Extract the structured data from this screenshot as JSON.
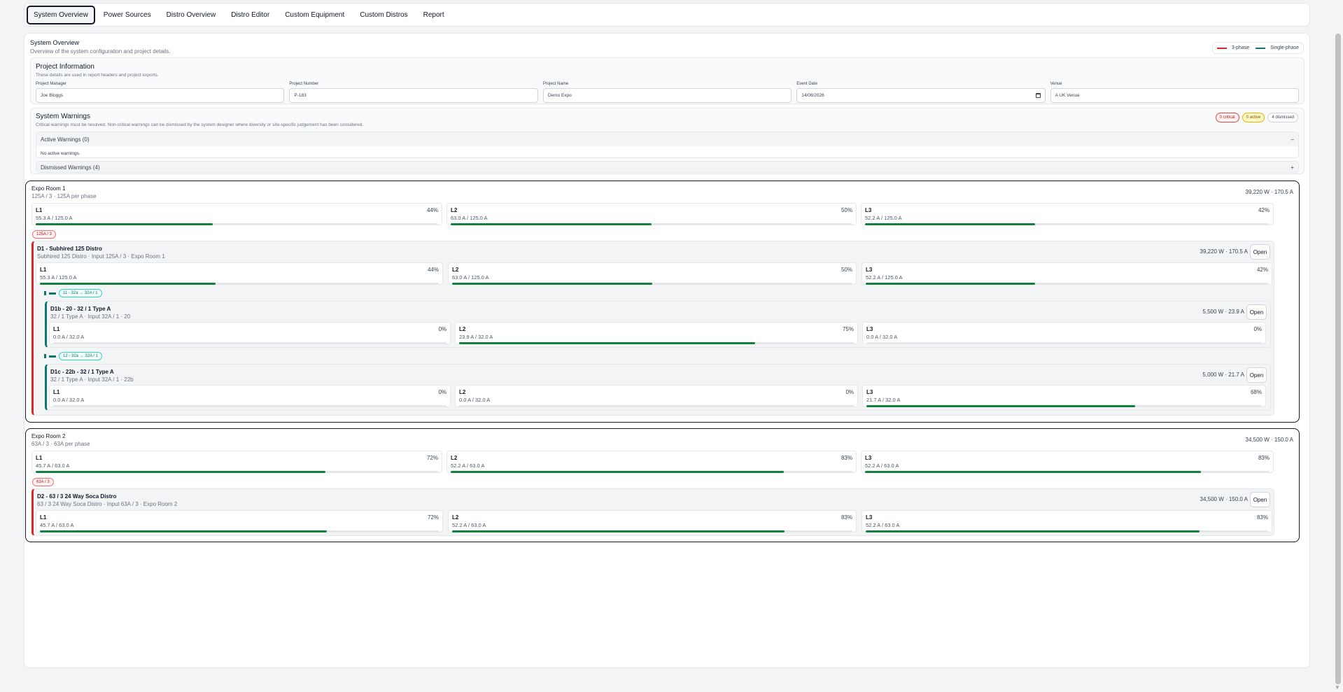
{
  "tabs": [
    "System Overview",
    "Power Sources",
    "Distro Overview",
    "Distro Editor",
    "Custom Equipment",
    "Custom Distros",
    "Report"
  ],
  "header": {
    "title": "System Overview",
    "subtitle": "Overview of the system configuration and project details.",
    "legend_3phase": "3-phase",
    "legend_single": "Single-phase",
    "color_3phase": "#dc2626",
    "color_single": "#0f766e"
  },
  "project": {
    "title": "Project Information",
    "subtitle": "These details are used in report headers and project exports.",
    "fields": [
      {
        "label": "Project Manager",
        "value": "Joe Bloggs"
      },
      {
        "label": "Project Number",
        "value": "P-183"
      },
      {
        "label": "Project Name",
        "value": "Demo Expo"
      },
      {
        "label": "Event Date",
        "value": "14/08/2026"
      },
      {
        "label": "Venue",
        "value": "A UK Venue"
      }
    ]
  },
  "warnings": {
    "title": "System Warnings",
    "subtitle": "Critical warnings must be resolved. Non-critical warnings can be dismissed by the system designer where diversity or site-specific judgement has been considered.",
    "badge_critical": "0 critical",
    "badge_active": "0 active",
    "badge_dismissed": "4 dismissed",
    "active_label": "Active Warnings (0)",
    "active_toggle": "–",
    "active_empty": "No active warnings.",
    "dismissed_label": "Dismissed Warnings (4)",
    "dismissed_toggle": "+"
  },
  "rooms": [
    {
      "name": "Expo Room 1",
      "sub": "125A / 3 · 125A per phase",
      "total": "39,220 W · 170.5 A",
      "phases": [
        {
          "name": "L1",
          "pct": "44%",
          "val": "55.3 A / 125.0 A",
          "fill": 0.44
        },
        {
          "name": "L2",
          "pct": "50%",
          "val": "63.0 A / 125.0 A",
          "fill": 0.5
        },
        {
          "name": "L3",
          "pct": "42%",
          "val": "52.2 A / 125.0 A",
          "fill": 0.42
        }
      ],
      "chip": "125A / 3",
      "distro": {
        "name": "D1 - Subhired 125 Distro",
        "sub": "Subhired 125 Distro · Input 125A / 3 · Expo Room 1",
        "total": "39,220 W · 170.5 A",
        "open": "Open",
        "phases": [
          {
            "name": "L1",
            "pct": "44%",
            "val": "55.3 A / 125.0 A",
            "fill": 0.44
          },
          {
            "name": "L2",
            "pct": "50%",
            "val": "63.0 A / 125.0 A",
            "fill": 0.5
          },
          {
            "name": "L3",
            "pct": "42%",
            "val": "52.2 A / 125.0 A",
            "fill": 0.42
          }
        ],
        "children": [
          {
            "chip": "11 - 32a → 32A / 1",
            "name": "D1b - 20 - 32 / 1 Type A",
            "sub": "32 / 1 Type A · Input 32A / 1 · 20",
            "total": "5,500 W · 23.9 A",
            "open": "Open",
            "phases": [
              {
                "name": "L1",
                "pct": "0%",
                "val": "0.0 A / 32.0 A",
                "fill": 0
              },
              {
                "name": "L2",
                "pct": "75%",
                "val": "23.9 A / 32.0 A",
                "fill": 0.75
              },
              {
                "name": "L3",
                "pct": "0%",
                "val": "0.0 A / 32.0 A",
                "fill": 0
              }
            ]
          },
          {
            "chip": "12 - 32a → 32A / 1",
            "name": "D1c - 22b - 32 / 1 Type A",
            "sub": "32 / 1 Type A · Input 32A / 1 · 22b",
            "total": "5,000 W · 21.7 A",
            "open": "Open",
            "phases": [
              {
                "name": "L1",
                "pct": "0%",
                "val": "0.0 A / 32.0 A",
                "fill": 0
              },
              {
                "name": "L2",
                "pct": "0%",
                "val": "0.0 A / 32.0 A",
                "fill": 0
              },
              {
                "name": "L3",
                "pct": "68%",
                "val": "21.7 A / 32.0 A",
                "fill": 0.68
              }
            ]
          }
        ]
      }
    },
    {
      "name": "Expo Room 2",
      "sub": "63A / 3 · 63A per phase",
      "total": "34,500 W · 150.0 A",
      "phases": [
        {
          "name": "L1",
          "pct": "72%",
          "val": "45.7 A / 63.0 A",
          "fill": 0.72
        },
        {
          "name": "L2",
          "pct": "83%",
          "val": "52.2 A / 63.0 A",
          "fill": 0.83
        },
        {
          "name": "L3",
          "pct": "83%",
          "val": "52.2 A / 63.0 A",
          "fill": 0.83
        }
      ],
      "chip": "63A / 3",
      "distro": {
        "name": "D2 - 63 / 3 24 Way Soca Distro",
        "sub": "63 / 3 24 Way Soca Distro · Input 63A / 3 · Expo Room 2",
        "total": "34,500 W · 150.0 A",
        "open": "Open",
        "phases": [
          {
            "name": "L1",
            "pct": "72%",
            "val": "45.7 A / 63.0 A",
            "fill": 0.72
          },
          {
            "name": "L2",
            "pct": "83%",
            "val": "52.2 A / 63.0 A",
            "fill": 0.83
          },
          {
            "name": "L3",
            "pct": "83%",
            "val": "52.2 A / 63.0 A",
            "fill": 0.83
          }
        ]
      }
    }
  ]
}
